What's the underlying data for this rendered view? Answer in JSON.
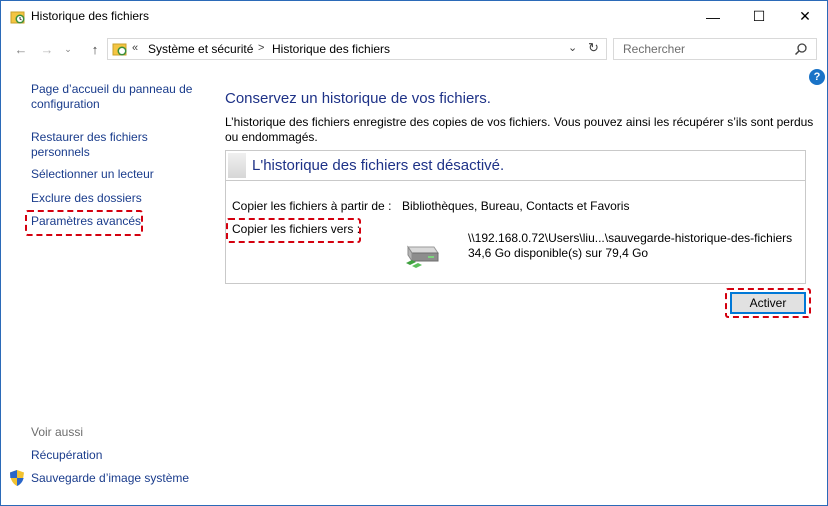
{
  "window": {
    "title": "Historique des fichiers",
    "controls": {
      "minimize": "—",
      "maximize": "☐",
      "close": "✕"
    }
  },
  "nav": {
    "back": "←",
    "forward": "→",
    "recent": "⌄",
    "up": "↑",
    "breadcrumb_prefix": "«",
    "breadcrumb": [
      "Système et sécurité",
      "Historique des fichiers"
    ],
    "breadcrumb_separator": ">",
    "dropdown": "⌄",
    "refresh": "↻",
    "search_placeholder": "Rechercher",
    "help": "?"
  },
  "sidebar": {
    "items": [
      {
        "label": "Page d’accueil du panneau de configuration"
      },
      {
        "label": "Restaurer des fichiers personnels"
      },
      {
        "label": "Sélectionner un lecteur"
      },
      {
        "label": "Exclure des dossiers"
      },
      {
        "label": "Paramètres avancés"
      }
    ],
    "see_also_label": "Voir aussi",
    "see_also": [
      {
        "label": "Récupération"
      },
      {
        "label": "Sauvegarde d’image système"
      }
    ]
  },
  "main": {
    "title": "Conservez un historique de vos fichiers.",
    "description": "L’historique des fichiers enregistre des copies de vos fichiers. Vous pouvez ainsi les récupérer s’ils sont perdus ou endommagés.",
    "status_title": "L'historique des fichiers est désactivé.",
    "copy_from_label": "Copier les fichiers à partir de :",
    "copy_from_value": "Bibliothèques, Bureau, Contacts et Favoris",
    "copy_to_label": "Copier les fichiers vers :",
    "drive_path": "\\\\192.168.0.72\\Users\\liu...\\sauvegarde-historique-des-fichiers",
    "drive_space": "34,6 Go disponible(s) sur 79,4 Go",
    "activate_button": "Activer"
  },
  "colors": {
    "link": "#1a3c8c",
    "heading": "#1e3287",
    "highlight": "#d4000f",
    "accent": "#0078d7"
  },
  "icons": {
    "title": "file-history-icon",
    "search": "search-icon",
    "shield": "shield-icon",
    "drive": "network-drive-icon"
  }
}
